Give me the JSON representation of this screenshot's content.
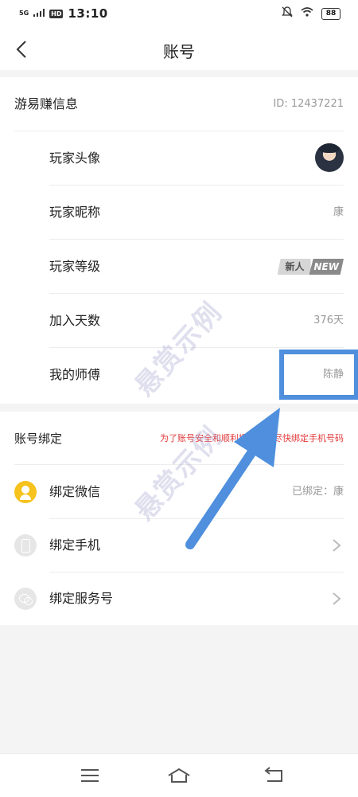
{
  "status_bar": {
    "network": "5G",
    "hd": "HD",
    "time": "13:10",
    "battery": "88"
  },
  "header": {
    "title": "账号"
  },
  "info_section": {
    "title": "游易赚信息",
    "id_text": "ID: 12437221",
    "rows": [
      {
        "label": "玩家头像"
      },
      {
        "label": "玩家昵称",
        "value": "康"
      },
      {
        "label": "玩家等级",
        "badge_left": "新人",
        "badge_right": "NEW"
      },
      {
        "label": "加入天数",
        "value": "376天"
      },
      {
        "label": "我的师傅",
        "value": "陈静"
      }
    ]
  },
  "binding_section": {
    "title": "账号绑定",
    "tip": "为了账号安全和顺利提现，请尽快绑定手机号码",
    "items": [
      {
        "label": "绑定微信",
        "value": "已绑定：康"
      },
      {
        "label": "绑定手机"
      },
      {
        "label": "绑定服务号"
      }
    ]
  },
  "watermark": {
    "text": "悬赏示例"
  },
  "colors": {
    "accent_red": "#e23a3a",
    "annotation_blue": "#4f8fdd",
    "wechat_yellow": "#f6c21c"
  }
}
